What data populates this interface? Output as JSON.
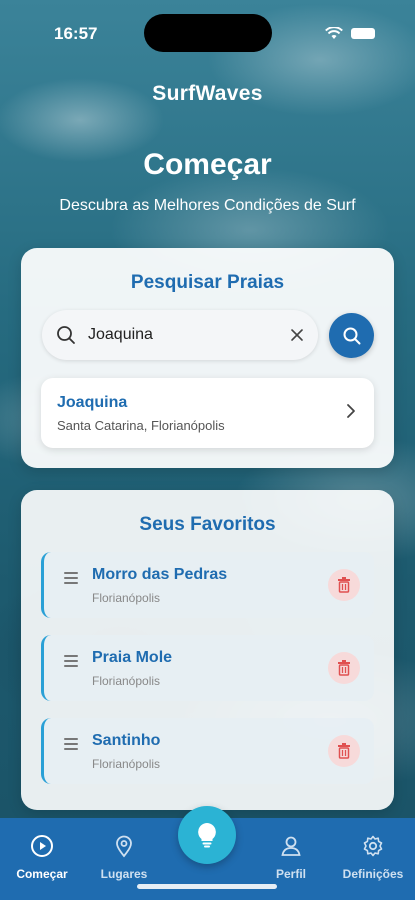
{
  "status_bar": {
    "time": "16:57"
  },
  "app": {
    "title": "SurfWaves"
  },
  "hero": {
    "title": "Começar",
    "subtitle": "Descubra as Melhores Condições de Surf"
  },
  "search": {
    "title": "Pesquisar Praias",
    "query": "Joaquina",
    "results": [
      {
        "name": "Joaquina",
        "location": "Santa Catarina, Florianópolis"
      }
    ]
  },
  "favorites": {
    "title": "Seus Favoritos",
    "items": [
      {
        "name": "Morro das Pedras",
        "city": "Florianópolis"
      },
      {
        "name": "Praia Mole",
        "city": "Florianópolis"
      },
      {
        "name": "Santinho",
        "city": "Florianópolis"
      }
    ]
  },
  "tabs": [
    {
      "label": "Começar",
      "icon": "play-circle-icon",
      "active": true
    },
    {
      "label": "Lugares",
      "icon": "map-pin-icon",
      "active": false
    },
    {
      "label": "Perfil",
      "icon": "user-icon",
      "active": false
    },
    {
      "label": "Definições",
      "icon": "gear-icon",
      "active": false
    }
  ],
  "fab": {
    "icon": "lightbulb-icon"
  },
  "colors": {
    "primary": "#1f6cb0",
    "accent": "#2bb3d4",
    "danger": "#e05050"
  }
}
